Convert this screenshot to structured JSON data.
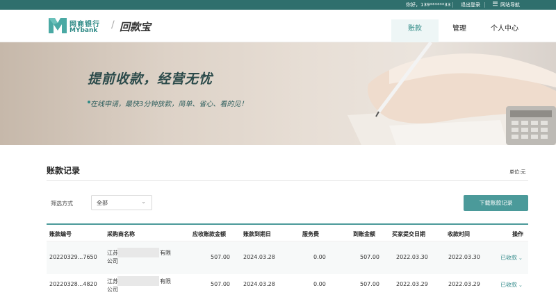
{
  "topbar": {
    "greeting": "你好，139******33",
    "logout": "退出登录",
    "site_nav_icon": "menu-icon",
    "site_nav": "网站导航"
  },
  "header": {
    "logo_cn": "网商银行",
    "logo_en": "MYbank",
    "slash": "/",
    "product": "回款宝",
    "nav": [
      "账款",
      "管理",
      "个人中心"
    ]
  },
  "banner": {
    "title": "提前收款，经营无忧",
    "subtitle": "在线申请，最快3分钟放款，简单、省心、看的见！"
  },
  "records": {
    "title": "账款记录",
    "unit": "单位:元",
    "filter_label": "筛选方式",
    "filter_value": "全部",
    "download_button": "下载账款记录",
    "columns": [
      "账款编号",
      "采购商名称",
      "应收账款金额",
      "账款到期日",
      "服务费",
      "到账金额",
      "买家提交日期",
      "收款时间",
      "操作"
    ],
    "rows": [
      {
        "id": "20220329...7650",
        "buyer_line1_prefix": "江苏",
        "buyer_line1_suffix": "有限",
        "buyer_line2": "公司",
        "amount": "507.00",
        "due": "2024.03.28",
        "fee": "0.00",
        "received": "507.00",
        "submitted": "2022.03.30",
        "paid_time": "2022.03.30",
        "status": "已收款"
      },
      {
        "id": "20220328...4820",
        "buyer_line1_prefix": "江苏",
        "buyer_line1_suffix": "有限",
        "buyer_line2": "公司",
        "amount": "507.00",
        "due": "2024.03.28",
        "fee": "0.00",
        "received": "507.00",
        "submitted": "2022.03.29",
        "paid_time": "2022.03.29",
        "status": "已收款"
      }
    ]
  },
  "colors": {
    "brand": "#2f8a86",
    "topbar": "#2f6f6d",
    "button": "#4b9a9a"
  }
}
